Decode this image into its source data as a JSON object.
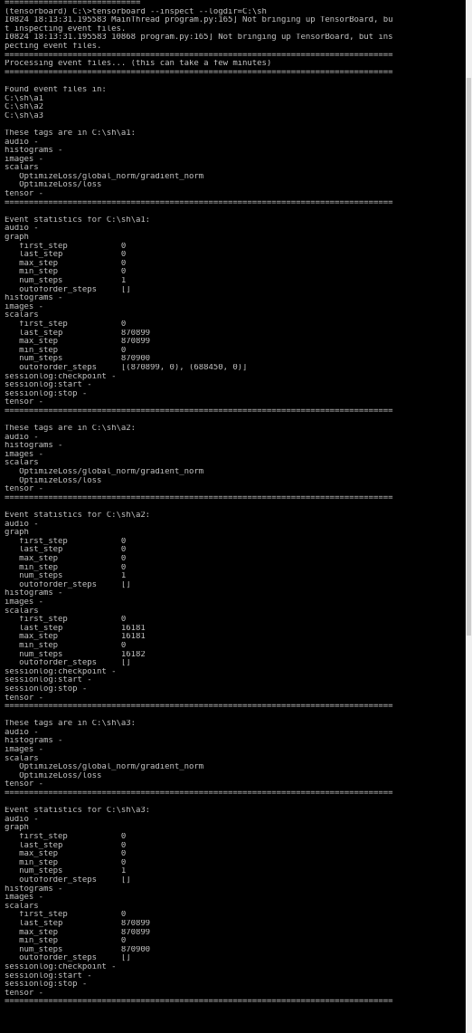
{
  "console": {
    "lines": [
      "============================",
      "(tensorboard) C:\\>tensorboard --inspect --logdir=C:\\sh",
      "I0824 18:13:31.195583 MainThread program.py:165] Not bringing up TensorBoard, bu",
      "t inspecting event files.",
      "I0824 18:13:31.195583 10868 program.py:165] Not bringing up TensorBoard, but ins",
      "pecting event files.",
      "================================================================================",
      "Processing event files... (this can take a few minutes)",
      "================================================================================",
      "",
      "Found event files in:",
      "C:\\sh\\a1",
      "C:\\sh\\a2",
      "C:\\sh\\a3",
      "",
      "These tags are in C:\\sh\\a1:",
      "audio -",
      "histograms -",
      "images -",
      "scalars",
      "   OptimizeLoss/global_norm/gradient_norm",
      "   OptimizeLoss/loss",
      "tensor -",
      "================================================================================",
      "",
      "Event statistics for C:\\sh\\a1:",
      "audio -",
      "graph",
      "   first_step           0",
      "   last_step            0",
      "   max_step             0",
      "   min_step             0",
      "   num_steps            1",
      "   outoforder_steps     []",
      "histograms -",
      "images -",
      "scalars",
      "   first_step           0",
      "   last_step            870899",
      "   max_step             870899",
      "   min_step             0",
      "   num_steps            870900",
      "   outoforder_steps     [(870899, 0), (688450, 0)]",
      "sessionlog:checkpoint -",
      "sessionlog:start -",
      "sessionlog:stop -",
      "tensor -",
      "================================================================================",
      "",
      "These tags are in C:\\sh\\a2:",
      "audio -",
      "histograms -",
      "images -",
      "scalars",
      "   OptimizeLoss/global_norm/gradient_norm",
      "   OptimizeLoss/loss",
      "tensor -",
      "================================================================================",
      "",
      "Event statistics for C:\\sh\\a2:",
      "audio -",
      "graph",
      "   first_step           0",
      "   last_step            0",
      "   max_step             0",
      "   min_step             0",
      "   num_steps            1",
      "   outoforder_steps     []",
      "histograms -",
      "images -",
      "scalars",
      "   first_step           0",
      "   last_step            16181",
      "   max_step             16181",
      "   min_step             0",
      "   num_steps            16182",
      "   outoforder_steps     []",
      "sessionlog:checkpoint -",
      "sessionlog:start -",
      "sessionlog:stop -",
      "tensor -",
      "================================================================================",
      "",
      "These tags are in C:\\sh\\a3:",
      "audio -",
      "histograms -",
      "images -",
      "scalars",
      "   OptimizeLoss/global_norm/gradient_norm",
      "   OptimizeLoss/loss",
      "tensor -",
      "================================================================================",
      "",
      "Event statistics for C:\\sh\\a3:",
      "audio -",
      "graph",
      "   first_step           0",
      "   last_step            0",
      "   max_step             0",
      "   min_step             0",
      "   num_steps            1",
      "   outoforder_steps     []",
      "histograms -",
      "images -",
      "scalars",
      "   first_step           0",
      "   last_step            870899",
      "   max_step             870899",
      "   min_step             0",
      "   num_steps            870900",
      "   outoforder_steps     []",
      "sessionlog:checkpoint -",
      "sessionlog:start -",
      "sessionlog:stop -",
      "tensor -",
      "================================================================================"
    ]
  },
  "colors": {
    "background": "#000000",
    "text": "#c0c0c0",
    "scrollbar_track": "#f0f0f0",
    "scrollbar_thumb": "#cdcdcd"
  },
  "scrollbar": {
    "thumb_start_fraction": 0.075,
    "thumb_length_fraction": 0.54
  }
}
